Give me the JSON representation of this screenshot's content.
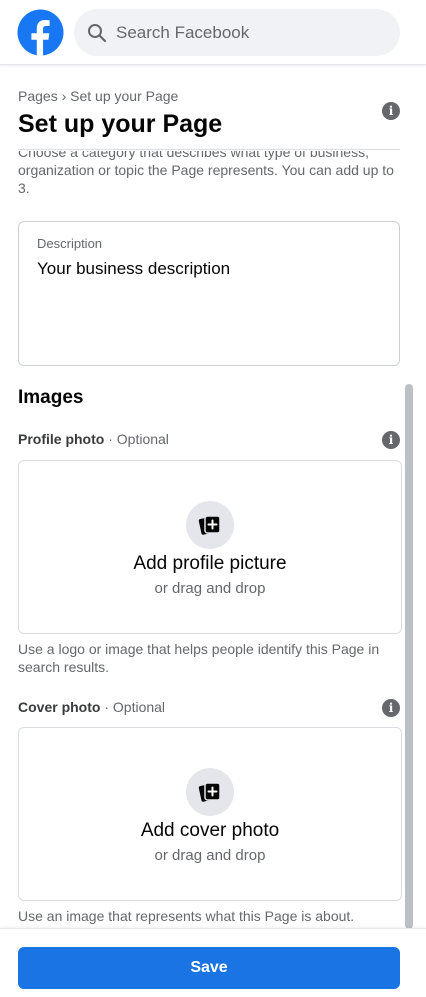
{
  "header": {
    "search_placeholder": "Search Facebook"
  },
  "breadcrumb": {
    "root": "Pages",
    "separator": "›",
    "current": "Set up your Page"
  },
  "page_title": "Set up your Page",
  "category_help": "Choose a category that describes what type of business, organization or topic the Page represents. You can add up to 3.",
  "description": {
    "label": "Description",
    "value": "Your business description"
  },
  "images": {
    "section_title": "Images",
    "profile": {
      "label": "Profile photo",
      "optional": "· Optional",
      "title": "Add profile picture",
      "sub": "or drag and drop",
      "help": "Use a logo or image that helps people identify this Page in search results."
    },
    "cover": {
      "label": "Cover photo",
      "optional": "· Optional",
      "title": "Add cover photo",
      "sub": "or drag and drop",
      "help": "Use an image that represents what this Page is about."
    }
  },
  "footer": {
    "save_label": "Save"
  },
  "colors": {
    "brand": "#1877f2",
    "button": "#1b74e4",
    "secondary_text": "#65676b"
  },
  "icons": {
    "logo": "facebook-logo",
    "search": "search-icon",
    "info": "info-icon",
    "add_photo": "add-photo-icon"
  }
}
